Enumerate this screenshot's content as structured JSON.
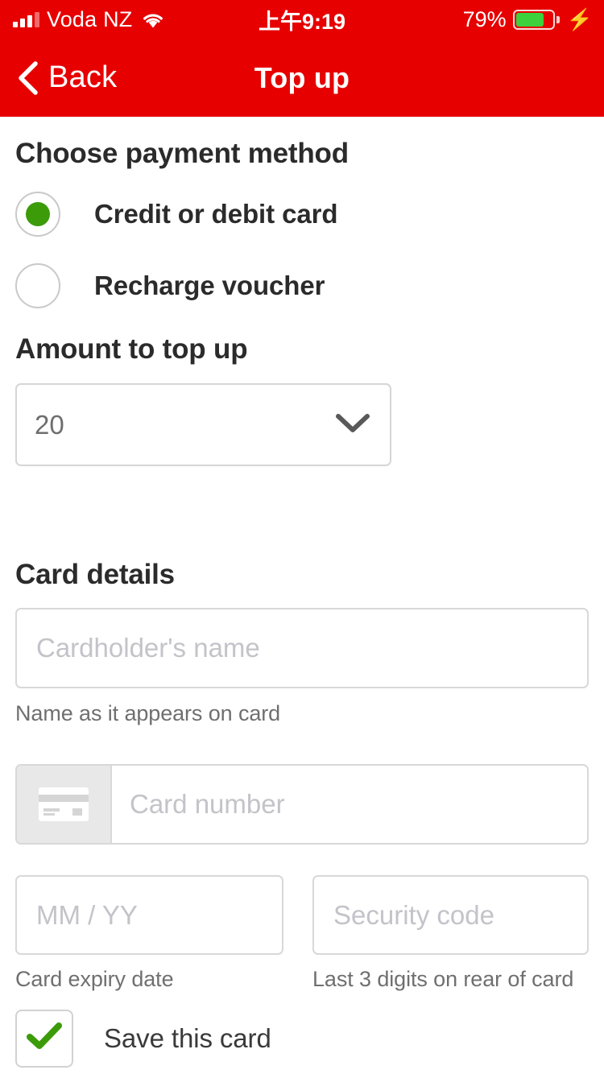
{
  "statusbar": {
    "carrier": "Voda NZ",
    "time": "上午9:19",
    "battery_percent": "79%",
    "battery_level": 79,
    "signal_bars_filled": 3,
    "signal_bars_total": 4,
    "wifi_icon": "wifi-icon",
    "charging_icon": "charging-bolt-icon",
    "charging": true
  },
  "navbar": {
    "back_label": "Back",
    "back_icon": "chevron-left-icon",
    "title": "Top up",
    "background_color": "#E60000"
  },
  "payment_method": {
    "heading": "Choose payment method",
    "selected": "credit-or-debit-card",
    "options": [
      {
        "id": "credit-or-debit-card",
        "label": "Credit or debit card",
        "selected": true
      },
      {
        "id": "recharge-voucher",
        "label": "Recharge voucher",
        "selected": false
      }
    ],
    "selected_color": "#3B9B09"
  },
  "amount": {
    "heading": "Amount to top up",
    "value": "20",
    "dropdown_icon": "chevron-down-icon"
  },
  "card_details": {
    "heading": "Card details",
    "cardholder": {
      "placeholder": "Cardholder's name",
      "value": "",
      "helper": "Name as it appears on card"
    },
    "card_number": {
      "placeholder": "Card number",
      "value": "",
      "icon": "credit-card-icon"
    },
    "expiry": {
      "placeholder": "MM / YY",
      "value": "",
      "helper": "Card expiry date"
    },
    "security_code": {
      "placeholder": "Security code",
      "value": "",
      "helper": "Last 3 digits on rear of card"
    },
    "save_card": {
      "label": "Save this card",
      "checked": true,
      "check_icon": "checkmark-icon",
      "check_color": "#3B9B09"
    }
  }
}
